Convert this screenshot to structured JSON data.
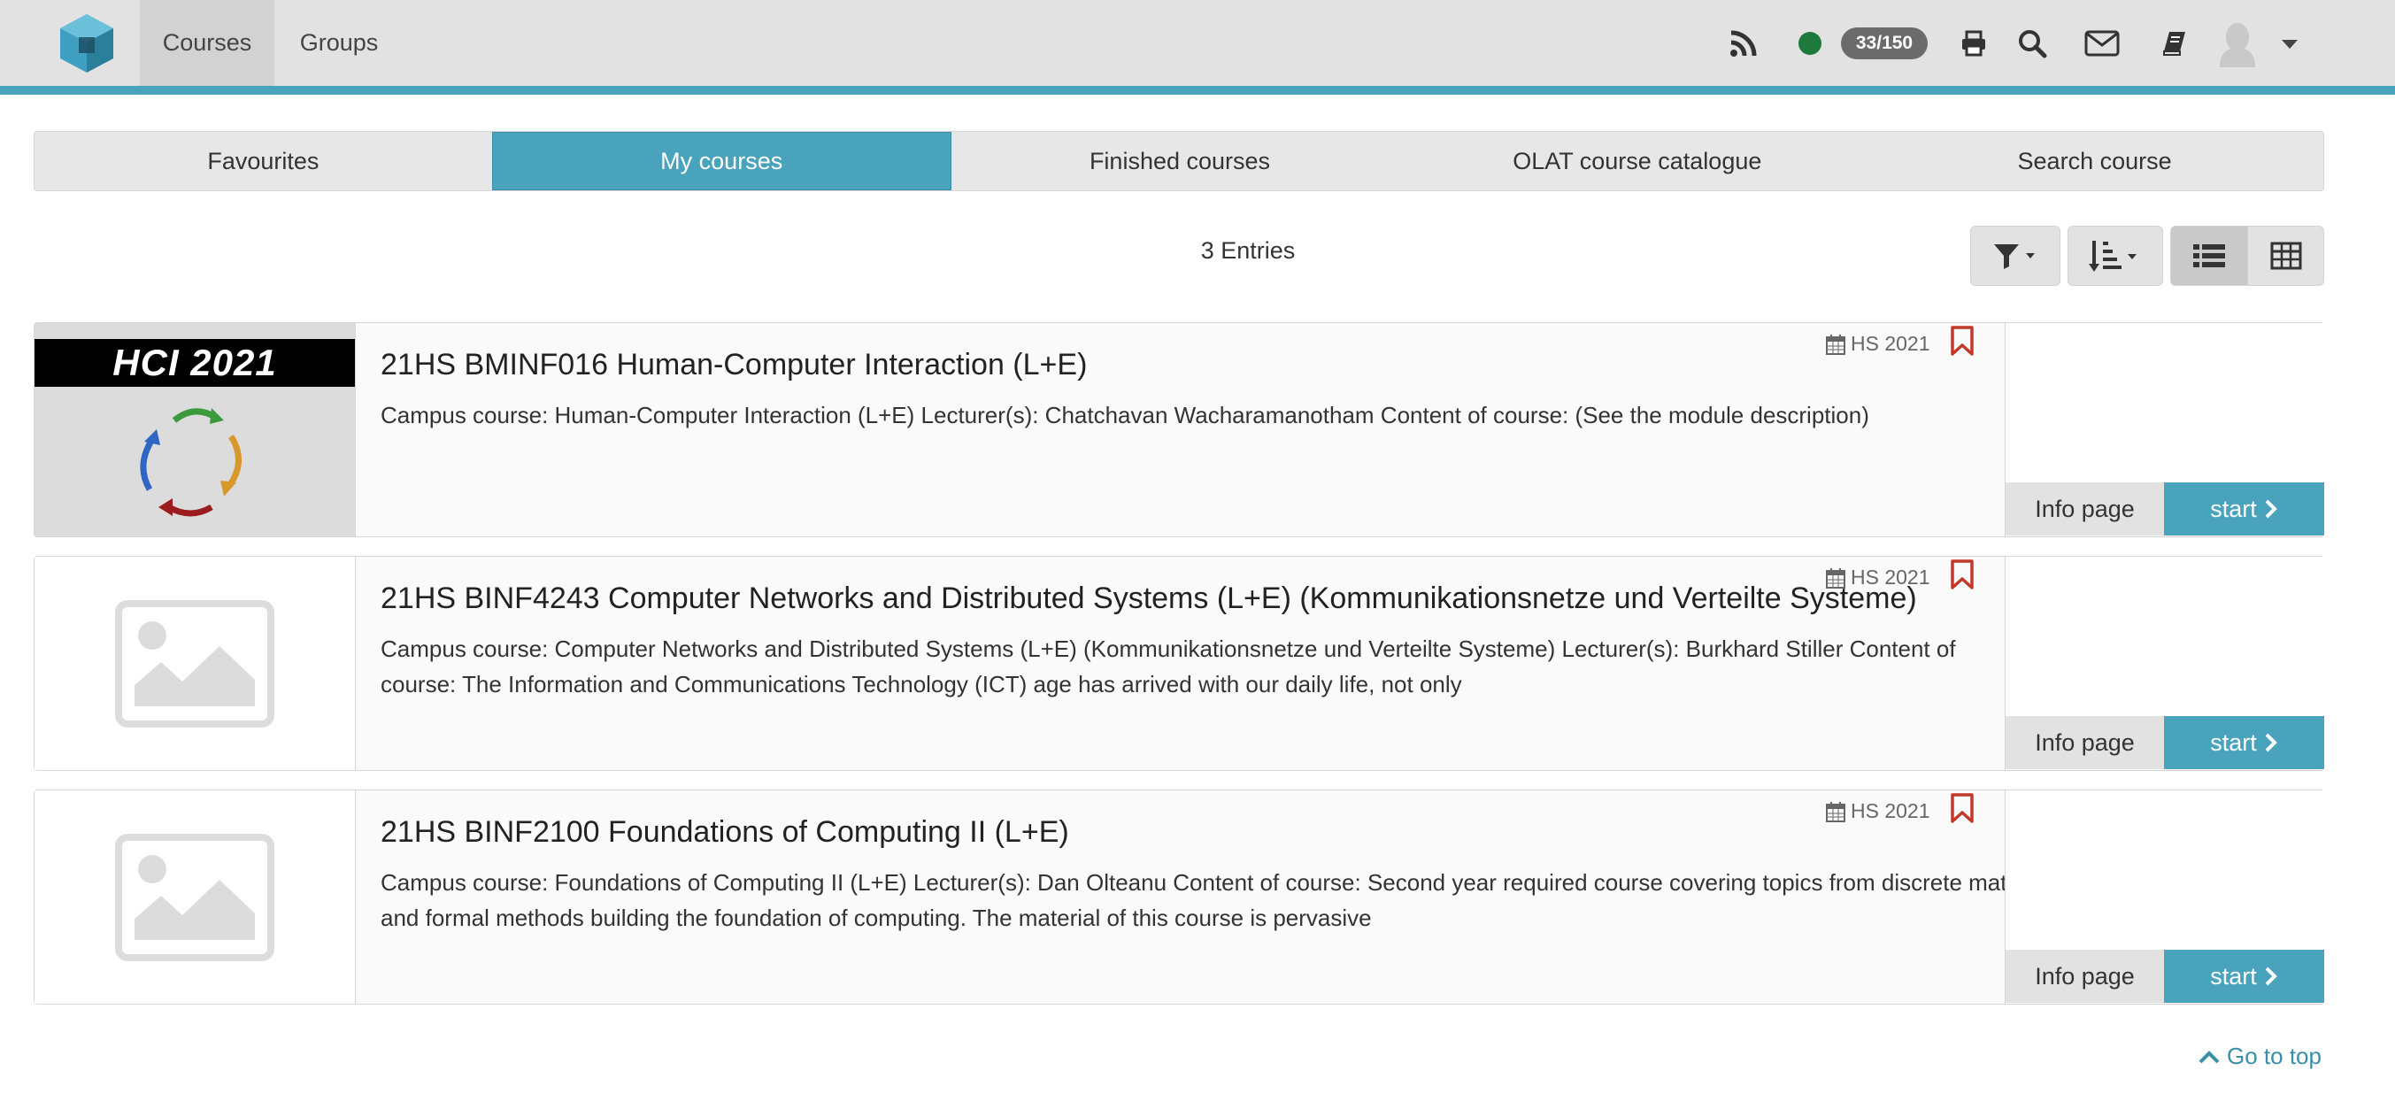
{
  "nav": {
    "tabs": [
      "Courses",
      "Groups"
    ],
    "badge": "33/150"
  },
  "segments": [
    "Favourites",
    "My courses",
    "Finished courses",
    "OLAT course catalogue",
    "Search course"
  ],
  "entries_label": "3 Entries",
  "courses": [
    {
      "title": "21HS BMINF016 Human-Computer Interaction (L+E)",
      "description": "Campus course: Human-Computer Interaction (L+E) Lecturer(s): Chatchavan Wacharamanotham Content of course: (See the module description)",
      "semester": "HS 2021",
      "thumbnail_text": "HCI 2021",
      "info_label": "Info page",
      "start_label": "start"
    },
    {
      "title": "21HS BINF4243 Computer Networks and Distributed Systems (L+E) (Kommunikationsnetze und Verteilte Systeme)",
      "description": "Campus course: Computer Networks and Distributed Systems (L+E) (Kommunikationsnetze und Verteilte Systeme) Lecturer(s): Burkhard Stiller Content of course: The Information and Communications Technology (ICT) age has arrived with our daily life, not only",
      "semester": "HS 2021",
      "info_label": "Info page",
      "start_label": "start"
    },
    {
      "title": "21HS BINF2100 Foundations of Computing II (L+E)",
      "description": "Campus course: Foundations of Computing II (L+E) Lecturer(s): Dan Olteanu Content of course: Second year required course covering topics from discrete math and formal methods building the foundation of computing. The material of this course is pervasive",
      "semester": "HS 2021",
      "info_label": "Info page",
      "start_label": "start"
    }
  ],
  "go_to_top": "Go to top",
  "colors": {
    "accent": "#4aa3bd",
    "navbar": "#e2e2e2",
    "bookmark": "#c0392b",
    "status_online": "#1e7a3c"
  }
}
